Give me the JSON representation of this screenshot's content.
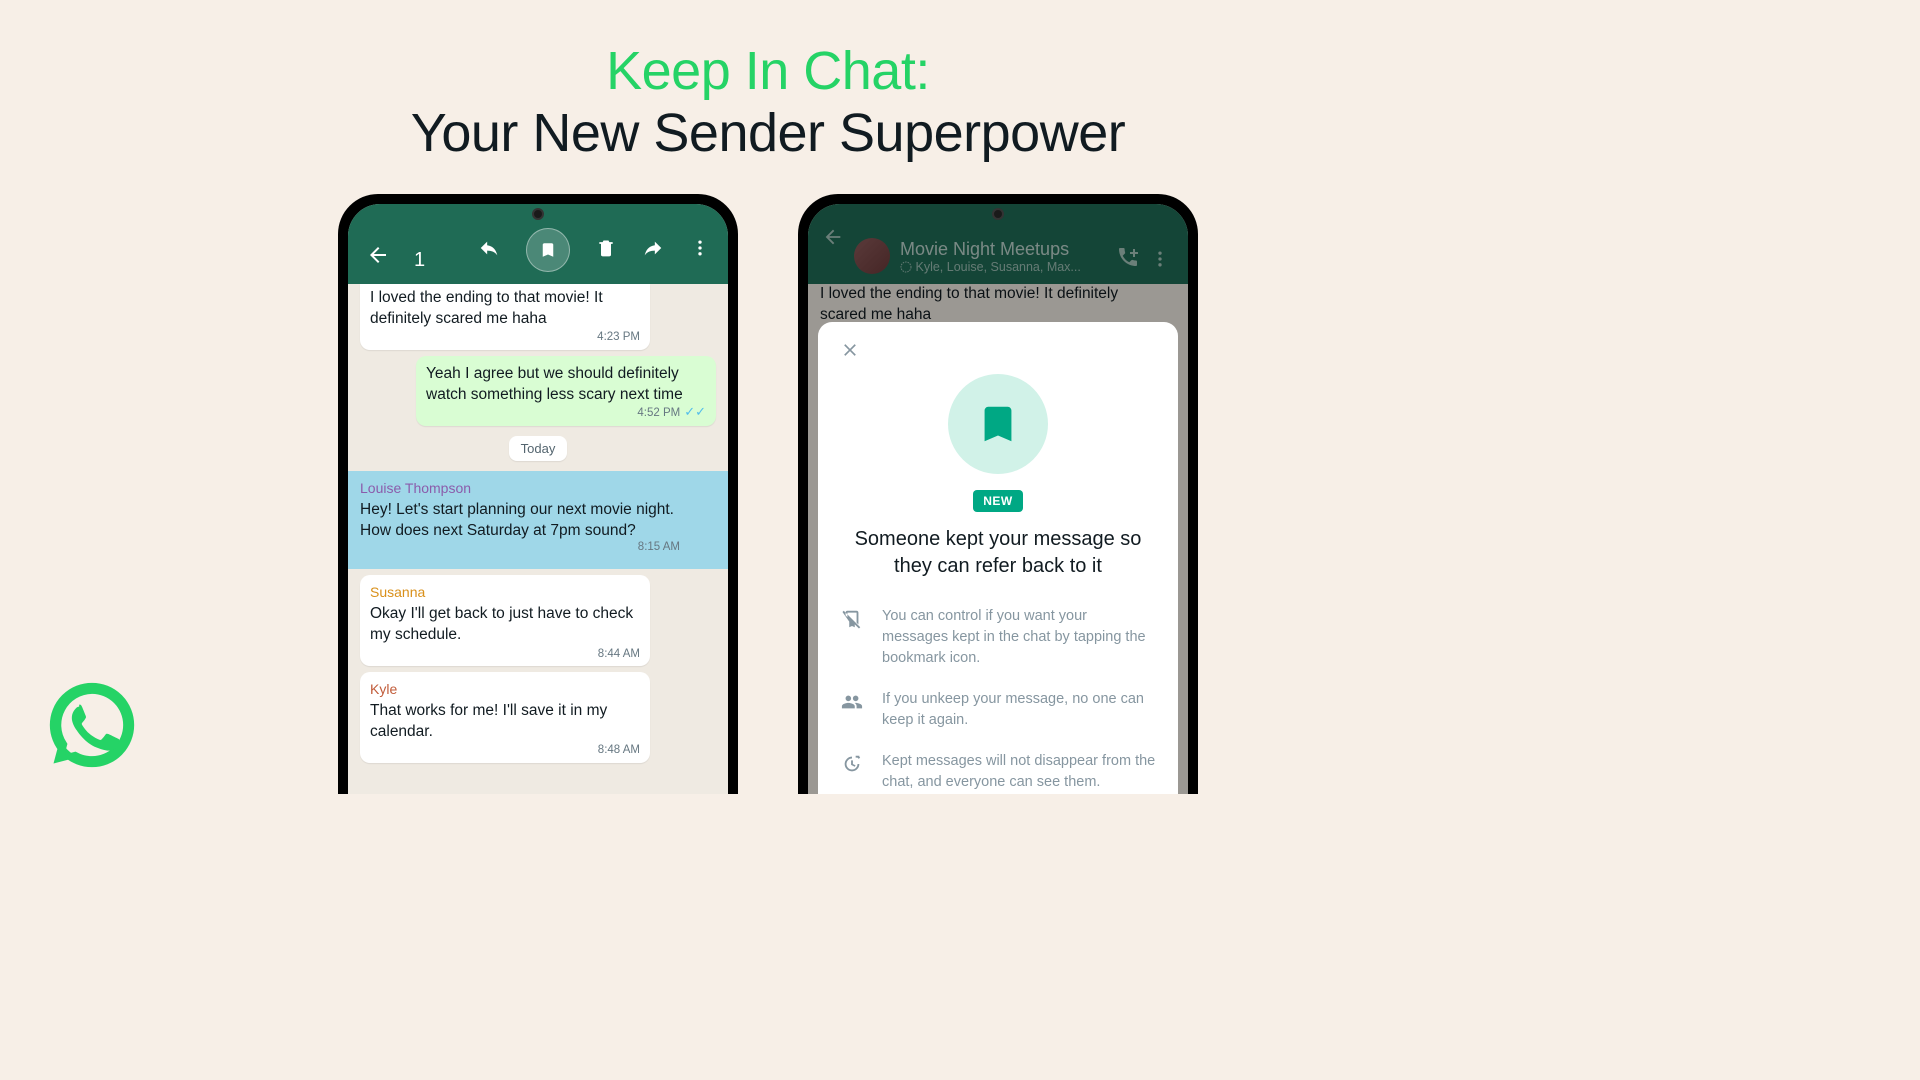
{
  "header": {
    "title1": "Keep In Chat:",
    "title2": "Your New Sender Superpower"
  },
  "leftPhone": {
    "selectedCount": "1",
    "messages": {
      "m0": {
        "text": "I loved the ending to that movie! It definitely scared me haha",
        "time": "4:23 PM"
      },
      "m1": {
        "text": "Yeah I agree but we should definitely watch something less scary next time",
        "time": "4:52 PM"
      },
      "dateChip": "Today",
      "m2": {
        "sender": "Louise Thompson",
        "senderColor": "#8b5cab",
        "text": "Hey! Let's start planning our next movie night. How does next Saturday at 7pm sound?",
        "time": "8:15 AM"
      },
      "m3": {
        "sender": "Susanna",
        "senderColor": "#d9901a",
        "text": "Okay I'll get back to just have to check my schedule.",
        "time": "8:44 AM"
      },
      "m4": {
        "sender": "Kyle",
        "senderColor": "#c15c3a",
        "text": "That works for me! I'll save it in my calendar.",
        "time": "8:48 AM"
      }
    }
  },
  "rightPhone": {
    "groupName": "Movie Night Meetups",
    "members": "Kyle, Louise, Susanna, Max...",
    "peekText": "I loved the ending to that movie! It definitely scared me haha",
    "modal": {
      "badge": "NEW",
      "title": "Someone kept your message so they can refer back to it",
      "point1": "You can control if you want your messages kept in the chat by tapping the bookmark icon.",
      "point2": "If you unkeep your message, no one can keep it again.",
      "point3": "Kept messages will not disappear from the chat, and everyone can see them."
    }
  }
}
